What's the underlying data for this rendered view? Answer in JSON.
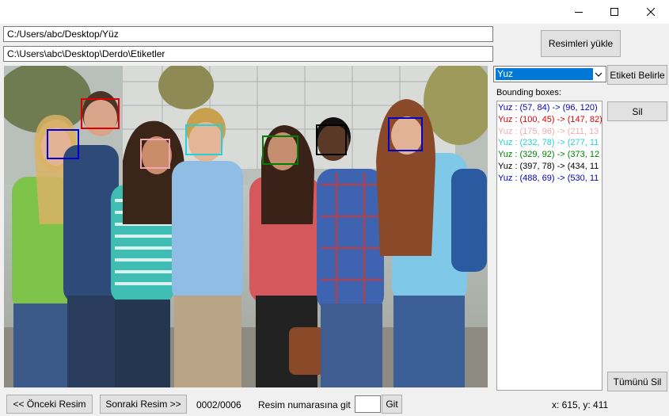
{
  "window": {
    "title_icons": [
      "minimize-icon",
      "maximize-icon",
      "close-icon"
    ]
  },
  "paths": {
    "images_dir": "C:/Users/abc/Desktop/Yüz",
    "labels_dir": "C:\\Users\\abc\\Desktop\\Derdo\\Etiketler"
  },
  "buttons": {
    "load_images": "Resimleri yükle",
    "set_label": "Etiketi Belirle",
    "delete": "Sil",
    "delete_all": "Tümünü Sil",
    "prev_image": "<< Önceki Resim",
    "next_image": "Sonraki Resim >>",
    "go": "Git"
  },
  "label_select": {
    "selected": "Yuz"
  },
  "bbox_panel": {
    "title": "Bounding boxes:",
    "items": [
      {
        "text": "Yuz : (57, 84) -> (96, 120)",
        "color": "#0000cc"
      },
      {
        "text": "Yuz : (100, 45) -> (147, 82)",
        "color": "#dd0000"
      },
      {
        "text": "Yuz : (175, 96) -> (211, 13",
        "color": "#f4a6b0"
      },
      {
        "text": "Yuz : (232, 78) -> (277, 11",
        "color": "#22d3d8"
      },
      {
        "text": "Yuz : (329, 92) -> (373, 12",
        "color": "#008000"
      },
      {
        "text": "Yuz : (397, 78) -> (434, 11",
        "color": "#000000"
      },
      {
        "text": "Yuz : (488, 69) -> (530, 11",
        "color": "#0000cc"
      }
    ]
  },
  "status": {
    "counter": "0002/0006",
    "goto_label": "Resim numarasına git",
    "goto_value": "",
    "cursor": "x: 615, y: 411"
  },
  "photo": {
    "description_icon": "group-photo-image",
    "box_colors": [
      "#0000cc",
      "#dd0000",
      "#f4a6b0",
      "#22d3d8",
      "#008000",
      "#000000",
      "#0000cc"
    ]
  }
}
